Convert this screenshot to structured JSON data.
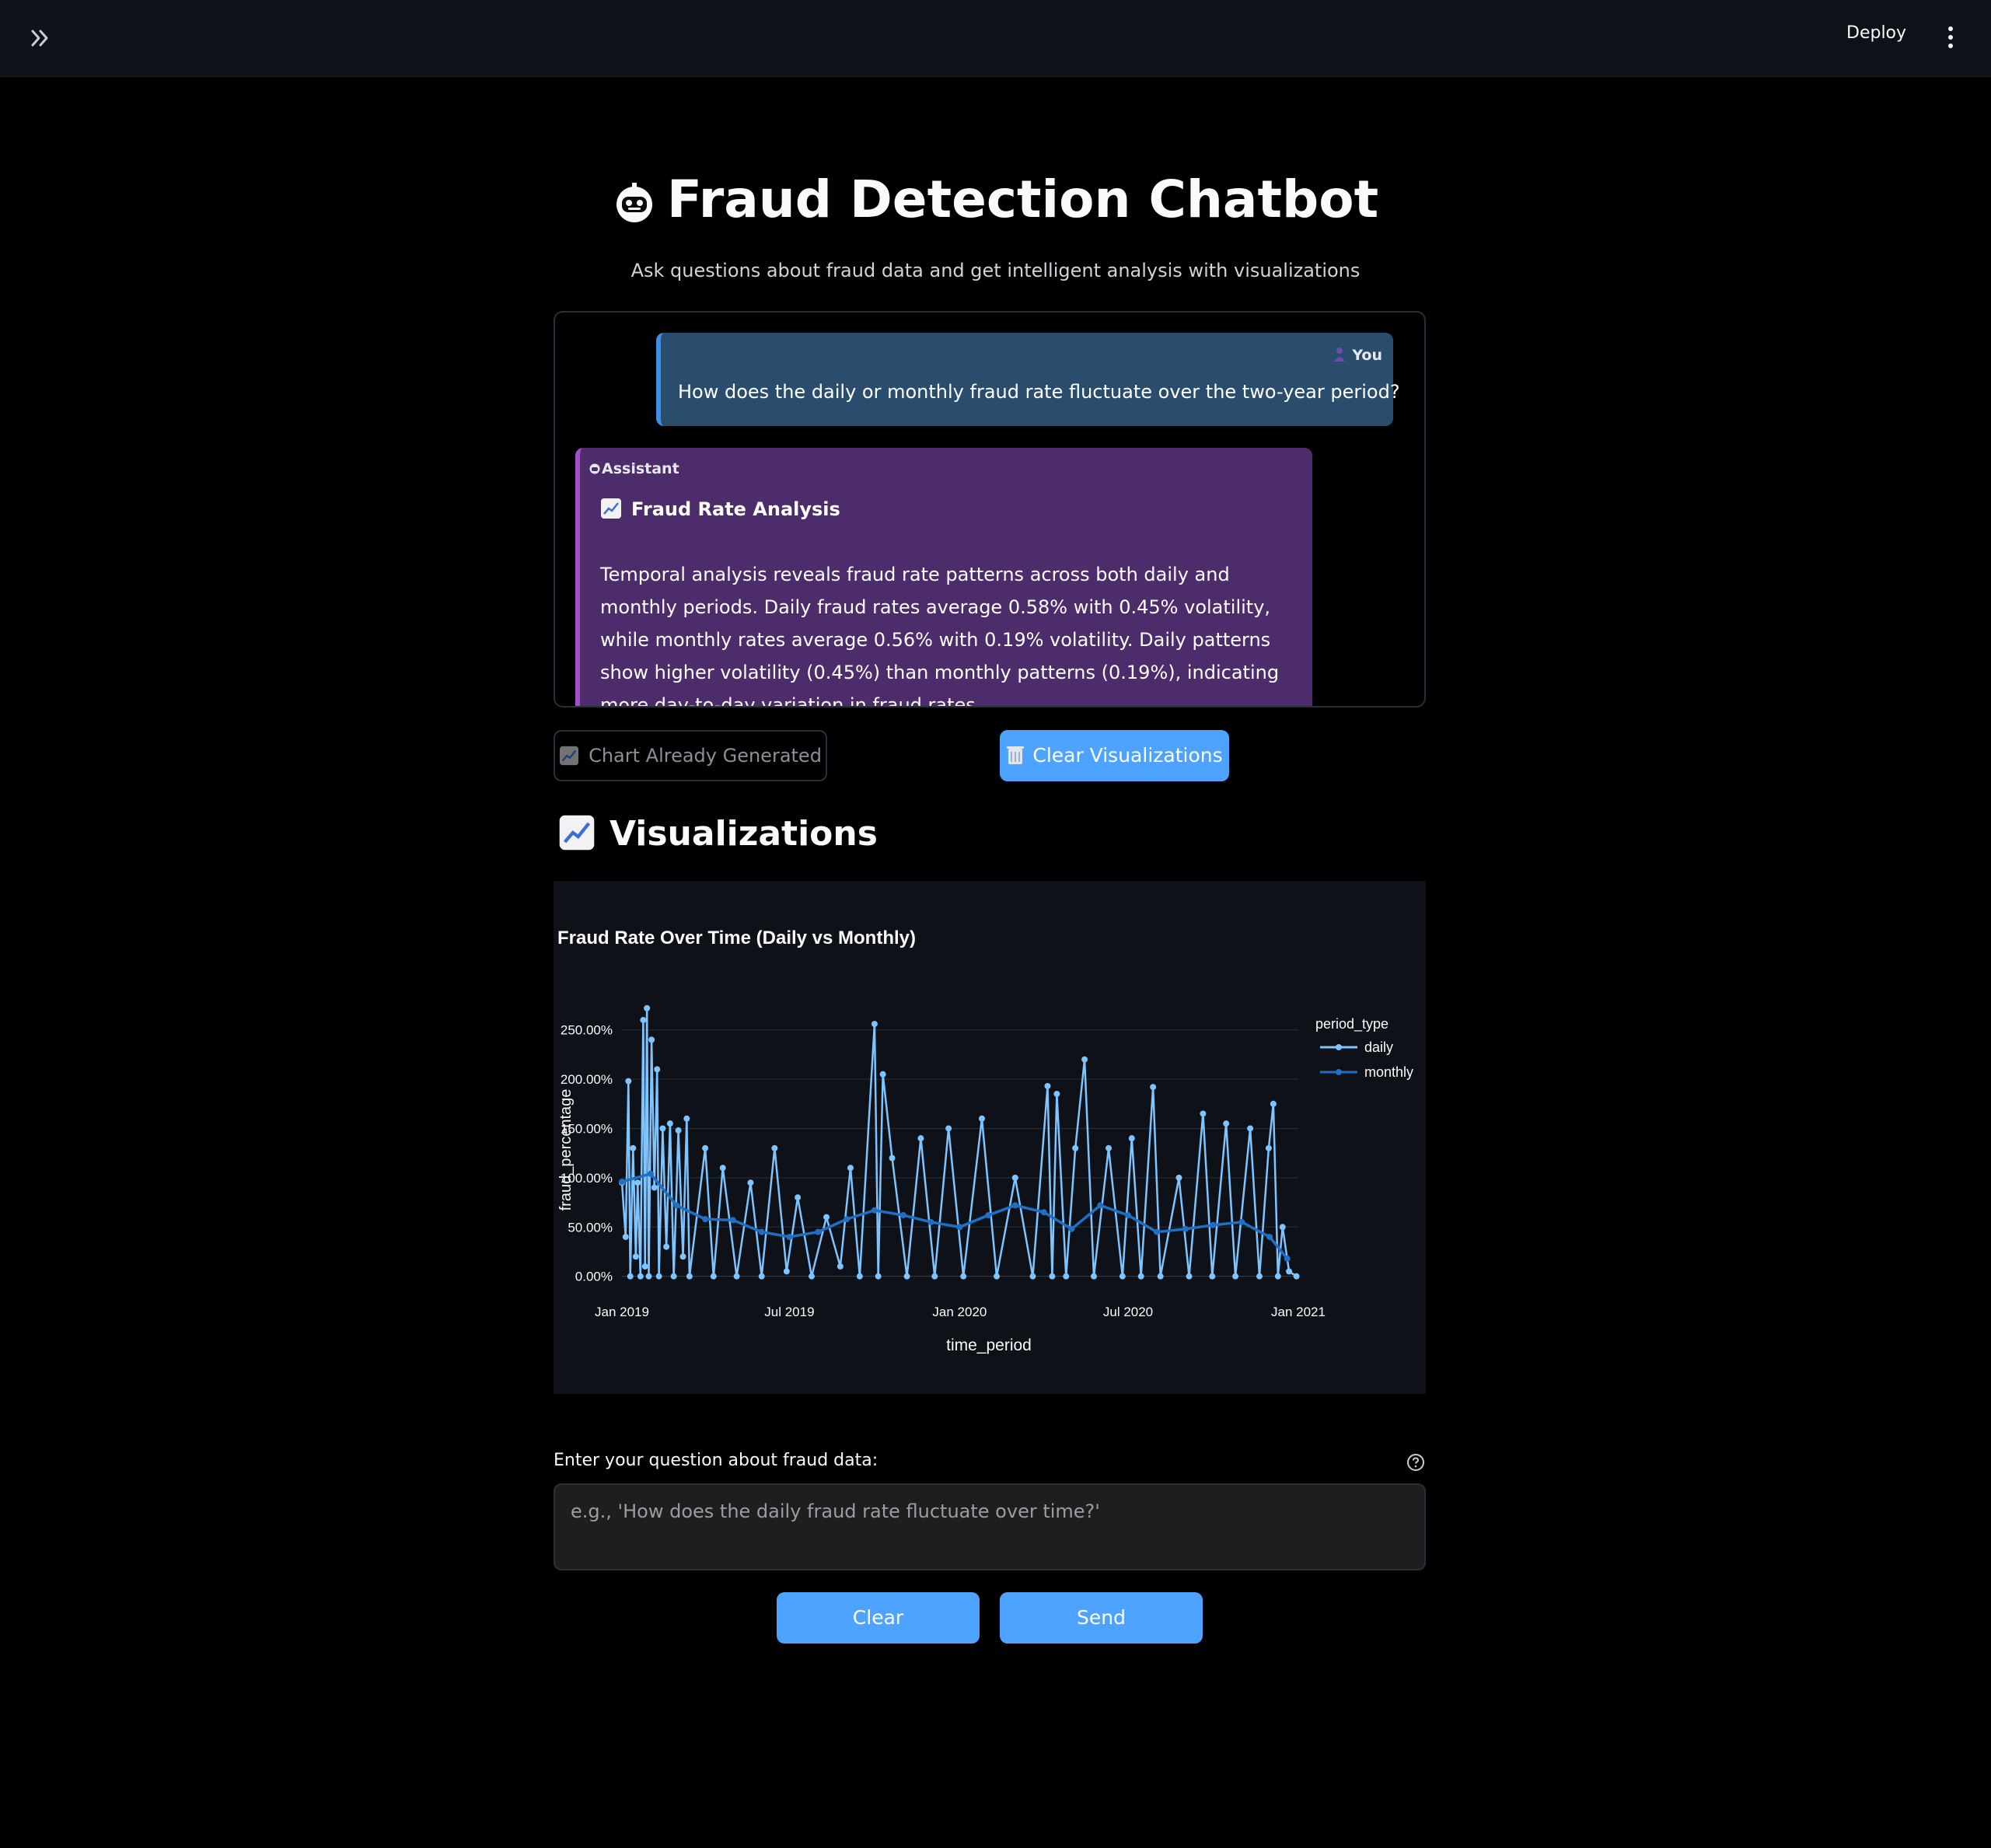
{
  "header": {
    "deploy_label": "Deploy"
  },
  "page": {
    "title": "Fraud Detection Chatbot",
    "subtitle": "Ask questions about fraud data and get intelligent analysis with visualizations"
  },
  "chat": {
    "user": {
      "label": "You",
      "text": "How does the daily or monthly fraud rate fluctuate over the two-year period?"
    },
    "assistant": {
      "label": "Assistant",
      "heading": "Fraud Rate Analysis",
      "body": "Temporal analysis reveals fraud rate patterns across both daily and monthly periods. Daily fraud rates average 0.58% with 0.45% volatility, while monthly rates average 0.56% with 0.19% volatility. Daily patterns show higher volatility (0.45%) than monthly patterns (0.19%), indicating more day-to-day variation in fraud rates."
    }
  },
  "actions": {
    "chart_generated_label": "Chart Already Generated",
    "clear_viz_label": "Clear Visualizations"
  },
  "viz": {
    "heading": "Visualizations"
  },
  "input": {
    "label": "Enter your question about fraud data:",
    "placeholder": "e.g., 'How does the daily fraud rate fluctuate over time?'",
    "value": "",
    "clear_label": "Clear",
    "send_label": "Send"
  },
  "colors": {
    "daily": "#7ec4ff",
    "monthly": "#1f6fc5",
    "user_bubble": "#2a4d6e",
    "assistant_bubble": "#4c2c6b",
    "primary_button": "#4da3ff"
  },
  "chart_data": {
    "type": "line",
    "title": "Fraud Rate Over Time (Daily vs Monthly)",
    "xlabel": "time_period",
    "ylabel": "fraud_percentage",
    "legend_title": "period_type",
    "legend_position": "right",
    "x_ticks": [
      "Jan 2019",
      "Jul 2019",
      "Jan 2020",
      "Jul 2020",
      "Jan 2021"
    ],
    "y_ticks": [
      "0.00%",
      "50.00%",
      "100.00%",
      "150.00%",
      "200.00%",
      "250.00%"
    ],
    "xlim": [
      "2019-01-01",
      "2021-01-01"
    ],
    "ylim": [
      -5,
      275
    ],
    "grid": true,
    "series": [
      {
        "name": "daily",
        "points": [
          [
            "2019-01-01",
            95
          ],
          [
            "2019-01-05",
            40
          ],
          [
            "2019-01-08",
            198
          ],
          [
            "2019-01-10",
            0
          ],
          [
            "2019-01-13",
            130
          ],
          [
            "2019-01-16",
            20
          ],
          [
            "2019-01-18",
            95
          ],
          [
            "2019-01-21",
            0
          ],
          [
            "2019-01-24",
            260
          ],
          [
            "2019-01-26",
            10
          ],
          [
            "2019-01-28",
            272
          ],
          [
            "2019-01-30",
            0
          ],
          [
            "2019-02-02",
            240
          ],
          [
            "2019-02-05",
            90
          ],
          [
            "2019-02-08",
            210
          ],
          [
            "2019-02-10",
            0
          ],
          [
            "2019-02-14",
            150
          ],
          [
            "2019-02-18",
            30
          ],
          [
            "2019-02-22",
            155
          ],
          [
            "2019-02-26",
            0
          ],
          [
            "2019-03-03",
            148
          ],
          [
            "2019-03-08",
            20
          ],
          [
            "2019-03-12",
            160
          ],
          [
            "2019-03-15",
            0
          ],
          [
            "2019-04-01",
            130
          ],
          [
            "2019-04-10",
            0
          ],
          [
            "2019-04-20",
            110
          ],
          [
            "2019-05-05",
            0
          ],
          [
            "2019-05-20",
            95
          ],
          [
            "2019-06-01",
            0
          ],
          [
            "2019-06-15",
            130
          ],
          [
            "2019-06-28",
            5
          ],
          [
            "2019-07-10",
            80
          ],
          [
            "2019-07-25",
            0
          ],
          [
            "2019-08-10",
            60
          ],
          [
            "2019-08-25",
            10
          ],
          [
            "2019-09-05",
            110
          ],
          [
            "2019-09-15",
            0
          ],
          [
            "2019-10-01",
            256
          ],
          [
            "2019-10-05",
            0
          ],
          [
            "2019-10-10",
            205
          ],
          [
            "2019-10-20",
            120
          ],
          [
            "2019-11-05",
            0
          ],
          [
            "2019-11-20",
            140
          ],
          [
            "2019-12-05",
            0
          ],
          [
            "2019-12-20",
            150
          ],
          [
            "2020-01-05",
            0
          ],
          [
            "2020-01-25",
            160
          ],
          [
            "2020-02-10",
            0
          ],
          [
            "2020-03-01",
            100
          ],
          [
            "2020-03-20",
            0
          ],
          [
            "2020-04-05",
            193
          ],
          [
            "2020-04-10",
            0
          ],
          [
            "2020-04-15",
            185
          ],
          [
            "2020-04-25",
            0
          ],
          [
            "2020-05-05",
            130
          ],
          [
            "2020-05-15",
            220
          ],
          [
            "2020-05-25",
            0
          ],
          [
            "2020-06-10",
            130
          ],
          [
            "2020-06-25",
            0
          ],
          [
            "2020-07-05",
            140
          ],
          [
            "2020-07-15",
            0
          ],
          [
            "2020-07-28",
            192
          ],
          [
            "2020-08-05",
            0
          ],
          [
            "2020-08-25",
            100
          ],
          [
            "2020-09-05",
            0
          ],
          [
            "2020-09-20",
            165
          ],
          [
            "2020-09-30",
            0
          ],
          [
            "2020-10-15",
            155
          ],
          [
            "2020-10-25",
            0
          ],
          [
            "2020-11-10",
            150
          ],
          [
            "2020-11-20",
            0
          ],
          [
            "2020-11-30",
            130
          ],
          [
            "2020-12-05",
            175
          ],
          [
            "2020-12-10",
            0
          ],
          [
            "2020-12-15",
            50
          ],
          [
            "2020-12-22",
            5
          ],
          [
            "2020-12-30",
            0
          ]
        ]
      },
      {
        "name": "monthly",
        "points": [
          [
            "2019-01-01",
            96
          ],
          [
            "2019-02-01",
            104
          ],
          [
            "2019-03-01",
            72
          ],
          [
            "2019-04-01",
            58
          ],
          [
            "2019-05-01",
            57
          ],
          [
            "2019-06-01",
            45
          ],
          [
            "2019-07-01",
            40
          ],
          [
            "2019-08-01",
            45
          ],
          [
            "2019-09-01",
            58
          ],
          [
            "2019-10-01",
            67
          ],
          [
            "2019-11-01",
            62
          ],
          [
            "2019-12-01",
            55
          ],
          [
            "2020-01-01",
            50
          ],
          [
            "2020-02-01",
            62
          ],
          [
            "2020-03-01",
            72
          ],
          [
            "2020-04-01",
            65
          ],
          [
            "2020-05-01",
            48
          ],
          [
            "2020-06-01",
            72
          ],
          [
            "2020-07-01",
            62
          ],
          [
            "2020-08-01",
            45
          ],
          [
            "2020-09-01",
            48
          ],
          [
            "2020-10-01",
            52
          ],
          [
            "2020-11-01",
            55
          ],
          [
            "2020-12-01",
            40
          ],
          [
            "2020-12-20",
            18
          ]
        ]
      }
    ]
  }
}
